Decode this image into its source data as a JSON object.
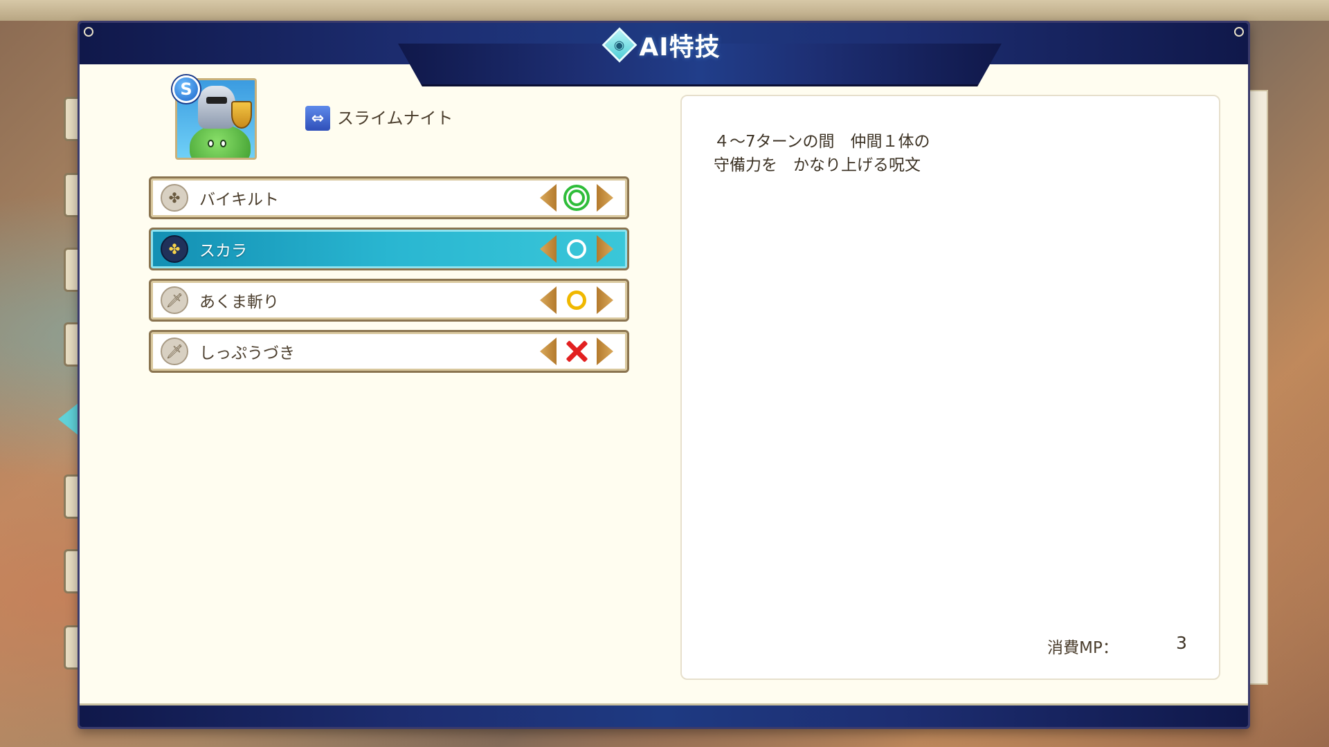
{
  "title": "AI特技",
  "monster": {
    "rank": "S",
    "name": "スライムナイト",
    "type_icon": "swap-arrows-icon"
  },
  "skills": [
    {
      "label": "バイキルト",
      "icon": "spell-icon",
      "priority": "double-circle",
      "selected": false
    },
    {
      "label": "スカラ",
      "icon": "spell-icon",
      "priority": "circle",
      "selected": true
    },
    {
      "label": "あくま斬り",
      "icon": "sword-icon",
      "priority": "circle-yellow",
      "selected": false
    },
    {
      "label": "しっぷうづき",
      "icon": "sword-icon",
      "priority": "cross",
      "selected": false
    }
  ],
  "description": {
    "line1": "４～7ターンの間　仲間１体の",
    "line2": "守備力を　かなり上げる呪文",
    "mp_label": "消費MP：",
    "mp_value": "3"
  },
  "colors": {
    "header": "#1d2e72",
    "selected_row": "#29b6d1",
    "panel": "#fffdf0",
    "priority_double": "#2fbd3a",
    "priority_yellow": "#f0b800",
    "priority_cross": "#e22020"
  }
}
